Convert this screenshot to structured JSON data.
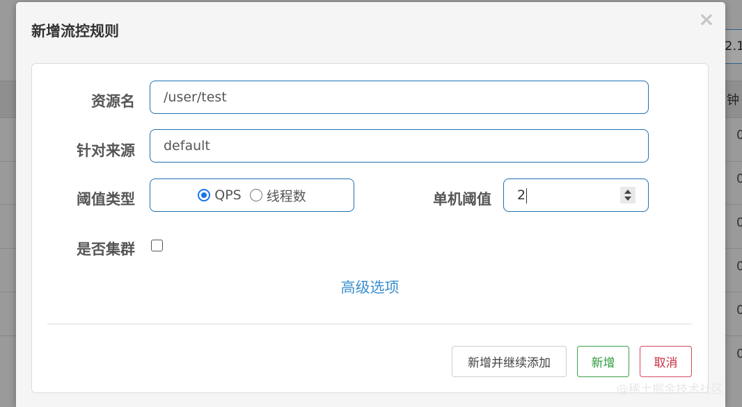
{
  "background": {
    "top_box_text": "2.1",
    "column_header": "钟",
    "row_values": [
      "0",
      "0",
      "0",
      "0",
      "0",
      "0"
    ]
  },
  "modal": {
    "title": "新增流控规则",
    "close_glyph": "×",
    "fields": {
      "resource_label": "资源名",
      "resource_value": "/user/test",
      "origin_label": "针对来源",
      "origin_value": "default",
      "threshold_type_label": "阈值类型",
      "threshold_type_options": [
        {
          "label": "QPS",
          "checked": true
        },
        {
          "label": "线程数",
          "checked": false
        }
      ],
      "single_threshold_label": "单机阈值",
      "single_threshold_value": "2",
      "cluster_label": "是否集群",
      "cluster_checked": false
    },
    "advanced_link": "高级选项",
    "buttons": {
      "add_continue": "新增并继续添加",
      "add": "新增",
      "cancel": "取消"
    }
  },
  "watermark": "@稀土掘金技术社区",
  "colors": {
    "accent_blue": "#1f6fb0",
    "link_blue": "#3a8fd0",
    "success_green": "#2e9a3e",
    "danger_red": "#c9303f"
  }
}
